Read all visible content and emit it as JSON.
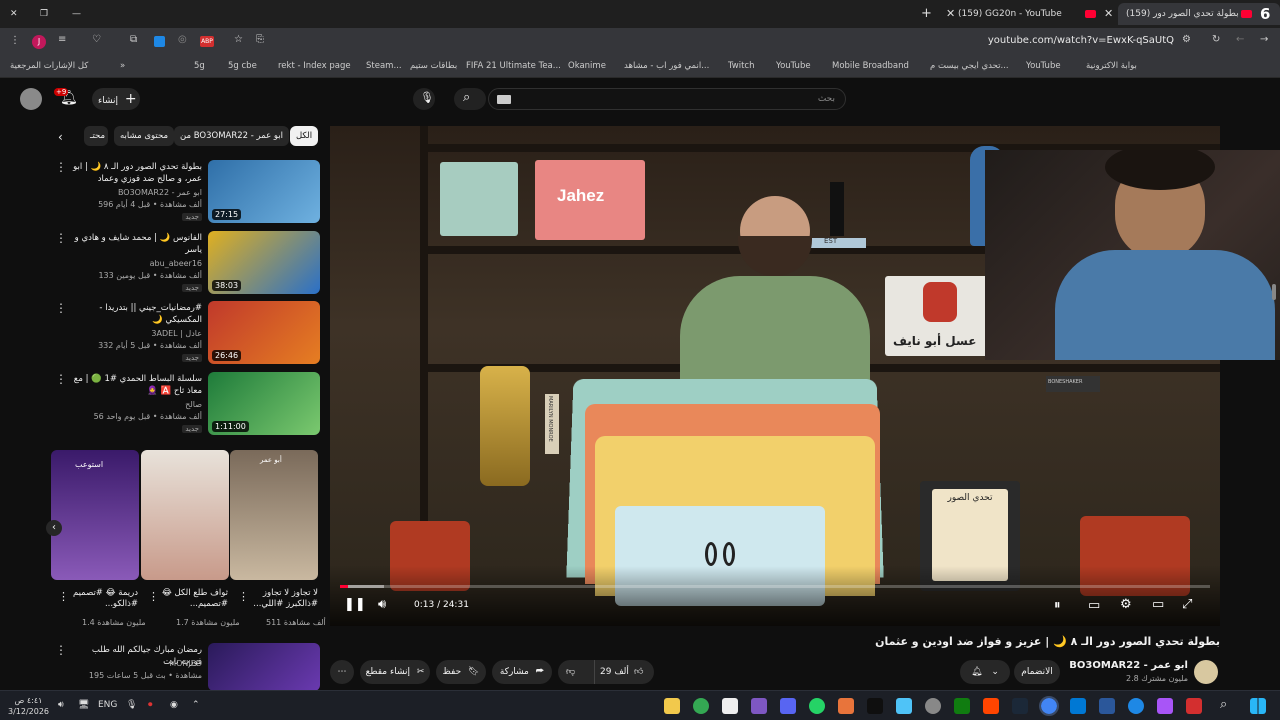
{
  "browser": {
    "tabs": [
      {
        "title": "(159) بطولة تحدي الصور دور",
        "active": true
      },
      {
        "title": "(159) GG20n - YouTube",
        "active": false
      }
    ],
    "new_tab": "+",
    "url": "youtube.com/watch?v=EwxK-qSaUtQ",
    "corner_badge": "6",
    "bookmarks": [
      "كل الإشارات المرجعية",
      "5g",
      "5g cbe",
      "rekt - Index page",
      "Steam...",
      "بطاقات ستيم",
      "FIFA 21 Ultimate Tea...",
      "Okanime",
      "انمي فور اب - مشاهد...",
      "Twitch",
      "YouTube",
      "Mobile Broadband",
      "تحدي ايجي بيست م...",
      "YouTube",
      "بوابة الاكترونية"
    ],
    "profile_initial": "J"
  },
  "youtube": {
    "search_placeholder": "بحث",
    "create_label": "إنشاء",
    "notifications_badge": "+9",
    "chips": [
      "الكل",
      "من BO3OMAR22 - ابو عمر",
      "محتوى مشابه",
      "محتـ"
    ],
    "recommendations": [
      {
        "title": "بطولة تحدي الصور دور الـ ٨ 🌙 | ابو عمر، و صالح ضد فوزي وعماد",
        "channel": "BO3OMAR22 - ابو عمر",
        "meta": "596 ألف مشاهدة • قبل 4 أيام",
        "tag": "جديد",
        "duration": "27:15"
      },
      {
        "title": "الفانوس 🌙 | محمد شايف و هادي و ياسر",
        "channel": "abu_abeer16",
        "meta": "133 ألف مشاهدة • قبل يومين",
        "tag": "جديد",
        "duration": "38:03"
      },
      {
        "title": "#رمضانيات_جيني || بتدريدا - المكسيكي 🌙",
        "channel": "3ADEL | عادل",
        "meta": "332 ألف مشاهدة • قبل 5 أيام",
        "tag": "جديد",
        "duration": "26:46"
      },
      {
        "title": "سلسلة البساط الحمدي #1 🟢 | مع معاذ ثاح 🅰️ 🧕",
        "channel": "صالح",
        "meta": "56 ألف مشاهدة • قبل يوم واحد",
        "tag": "جديد",
        "duration": "1:11:00"
      },
      {
        "title": "رمضان مبارك جيالكم الله طلب فورت نايت",
        "channel": "MONJED",
        "meta": "195 مشاهدة • بث قبل 5 ساعات",
        "tag": "",
        "duration": ""
      }
    ],
    "shorts": [
      {
        "title": "لا تجاوز لا تجاوز #ذالكبرز #اللي...",
        "views": "511 ألف مشاهدة",
        "label": "أبو عمر"
      },
      {
        "title": "ثواف طلع الكل 😂 #تصميم...",
        "views": "1.7 مليون مشاهدة",
        "label": ""
      },
      {
        "title": "دريمة 😂 #تصميم #ذالكو...",
        "views": "1.4 مليون مشاهدة",
        "label": "استوعب"
      }
    ],
    "player": {
      "time_current": "0:13",
      "time_total": "24:31",
      "progress": 0.009,
      "buffered": 0.05,
      "in_video_texts": [
        "Jahez",
        "عسل أبو نايف",
        "تحدي الصور",
        "MARILYN MONROE",
        "EST",
        "BONESHAKER"
      ]
    },
    "video_title": "بطولة تحدي الصور دور الـ ٨ 🌙 | عزيز و فواز ضد اودين و عثمان",
    "channel_name": "BO3OMAR22 - ابو عمر",
    "subscribers": "2.8 مليون مشترك",
    "join_label": "الانضمام",
    "likes": "29 ألف",
    "share_label": "مشاركة",
    "save_label": "حفظ",
    "clip_label": "إنشاء مقطع"
  },
  "taskbar": {
    "time": "٤:٤١ ص",
    "date": "3/12/2026",
    "language": "ENG"
  },
  "colors": {
    "accent": "#ff0033",
    "background": "#0f0f0f",
    "chip": "#272727"
  }
}
